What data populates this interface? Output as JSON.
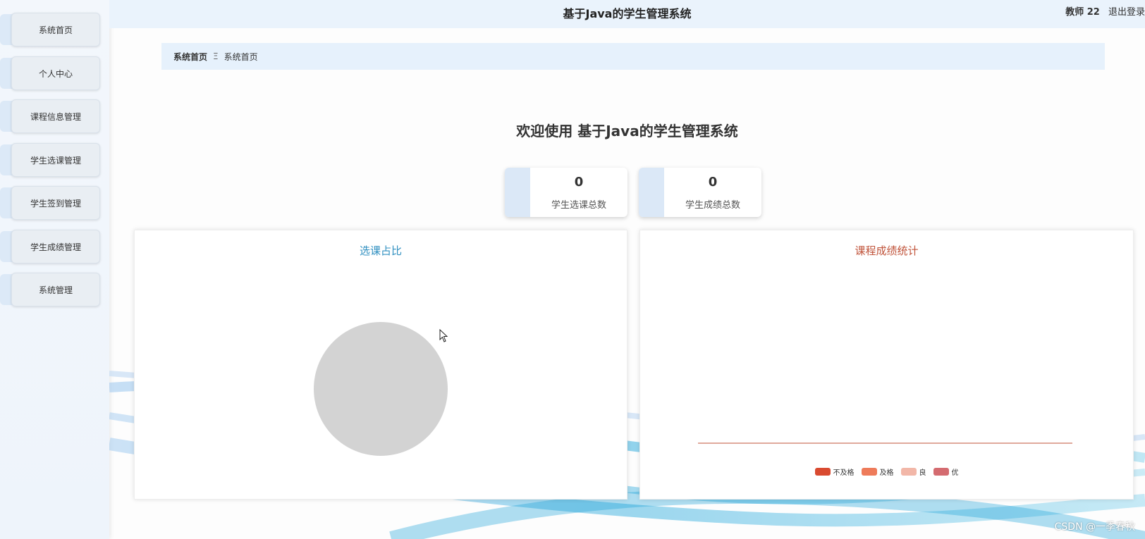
{
  "header": {
    "title": "基于Java的学生管理系统",
    "user_label": "教师 22",
    "logout_label": "退出登录"
  },
  "sidebar": {
    "items": [
      {
        "label": "系统首页"
      },
      {
        "label": "个人中心"
      },
      {
        "label": "课程信息管理"
      },
      {
        "label": "学生选课管理"
      },
      {
        "label": "学生签到管理"
      },
      {
        "label": "学生成绩管理"
      },
      {
        "label": "系统管理"
      }
    ]
  },
  "breadcrumb": {
    "first": "系统首页",
    "separator": "Ξ",
    "current": "系统首页"
  },
  "welcome": "欢迎使用 基于Java的学生管理系统",
  "stats": [
    {
      "value": "0",
      "label": "学生选课总数"
    },
    {
      "value": "0",
      "label": "学生成绩总数"
    }
  ],
  "panels": {
    "pie": {
      "title": "选课占比",
      "title_color": "#2f8fc0"
    },
    "bar": {
      "title": "课程成绩统计",
      "title_color": "#c0533a"
    }
  },
  "chart_data": [
    {
      "type": "pie",
      "title": "选课占比",
      "values": [],
      "note_empty": true
    },
    {
      "type": "bar",
      "title": "课程成绩统计",
      "categories": [],
      "series": [
        {
          "name": "不及格",
          "color": "#d94a30",
          "values": []
        },
        {
          "name": "及格",
          "color": "#ee7b5a",
          "values": []
        },
        {
          "name": "良",
          "color": "#f2b7a8",
          "values": []
        },
        {
          "name": "优",
          "color": "#d46b70",
          "values": []
        }
      ],
      "legend": "bottom-center"
    }
  ],
  "watermark": "CSDN @一季春秋"
}
